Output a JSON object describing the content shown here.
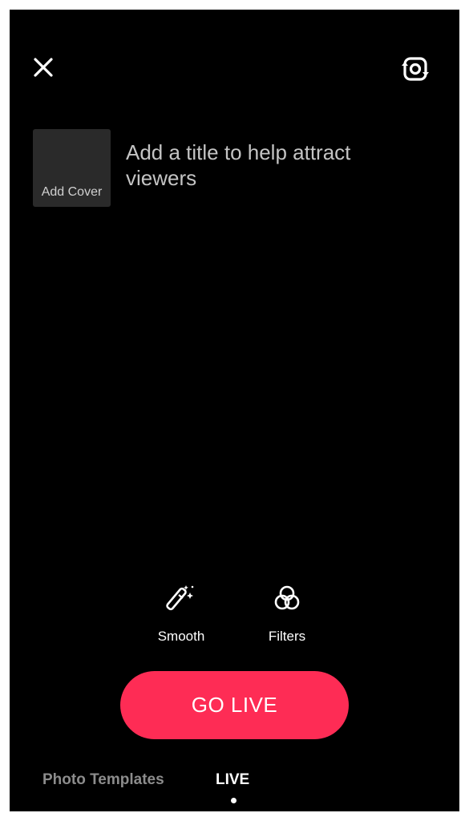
{
  "header": {
    "close_icon": "close-icon",
    "flip_camera_icon": "flip-camera-icon"
  },
  "cover": {
    "label": "Add Cover"
  },
  "title_input": {
    "placeholder": "Add a title to help attract viewers"
  },
  "tools": {
    "smooth": {
      "label": "Smooth",
      "icon": "magic-wand-icon"
    },
    "filters": {
      "label": "Filters",
      "icon": "filters-circles-icon"
    }
  },
  "go_live": {
    "label": "GO LIVE",
    "color": "#fe2c55"
  },
  "bottom_tabs": {
    "items": [
      {
        "label": "Photo Templates",
        "active": false
      },
      {
        "label": "LIVE",
        "active": true
      }
    ]
  }
}
